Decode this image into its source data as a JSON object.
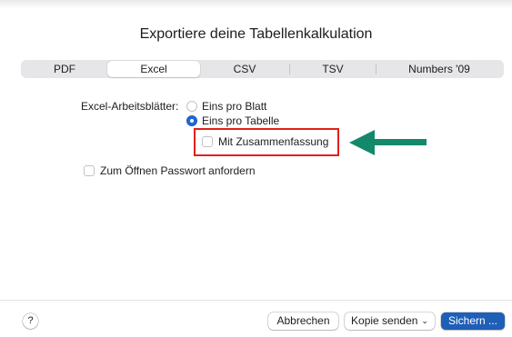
{
  "dialog": {
    "title": "Exportiere deine Tabellenkalkulation"
  },
  "tabs": [
    {
      "label": "PDF"
    },
    {
      "label": "Excel"
    },
    {
      "label": "CSV"
    },
    {
      "label": "TSV"
    },
    {
      "label": "Numbers '09"
    }
  ],
  "active_tab": "Excel",
  "options": {
    "sheets_label": "Excel-Arbeitsblätter:",
    "radio_one_per_sheet": "Eins pro Blatt",
    "radio_one_per_table": "Eins pro Tabelle",
    "selected_radio": "Eins pro Tabelle",
    "summary_checkbox": "Mit Zusammenfassung",
    "summary_checked": false,
    "password_checkbox": "Zum Öffnen Passwort anfordern",
    "password_checked": false
  },
  "annotation": {
    "highlight_color": "#e0201c",
    "arrow_color": "#13896b"
  },
  "footer": {
    "help": "?",
    "cancel": "Abbrechen",
    "send_copy": "Kopie senden",
    "save": "Sichern ..."
  },
  "colors": {
    "accent": "#1a68d8",
    "primary_button": "#1e5fb8"
  }
}
